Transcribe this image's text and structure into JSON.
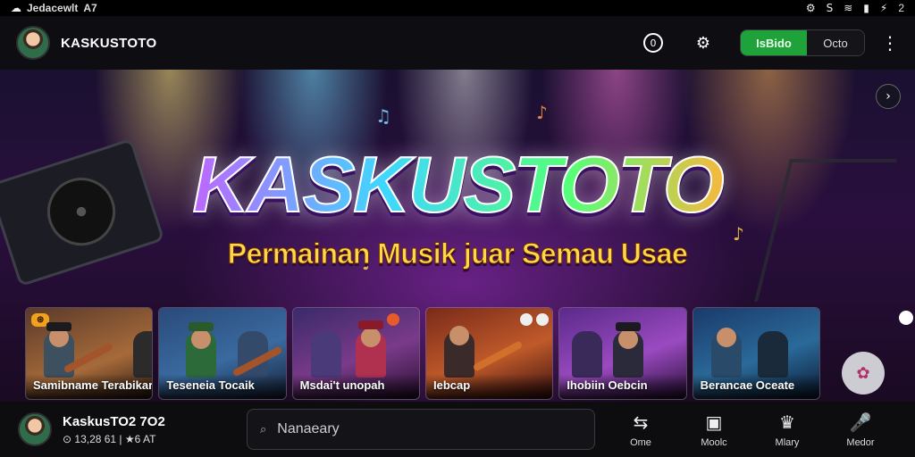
{
  "status_bar": {
    "left_icon": "cloud-icon",
    "left_text": "Jedacewlt",
    "clock": "A7",
    "right_glyphs": [
      "⚙",
      "S",
      "⚡"
    ],
    "battery_text": "2"
  },
  "app_bar": {
    "title": "KASKUSTOTO",
    "ring_button_text": "0",
    "toggle_on_label": "IsBido",
    "toggle_off_label": "Octo"
  },
  "hero": {
    "title": "KASKUSTOTO",
    "subtitle": "Permainan Musik juar Semau Usae"
  },
  "cards": [
    {
      "caption": "Samibname   Terabikar",
      "badge": ""
    },
    {
      "caption": "Teseneia Tocaik",
      "badge": ""
    },
    {
      "caption": "Msdai't unopah",
      "badge": ""
    },
    {
      "caption": "Iebcap",
      "badge": ""
    },
    {
      "caption": "Ihobiin Oebcin",
      "badge": ""
    },
    {
      "caption": "Berancae Oceate",
      "badge": ""
    }
  ],
  "bottom_bar": {
    "user_name": "KaskusTO2 7O2",
    "user_stats": "⊙ 13,28 61  |  ★6 AT",
    "search_placeholder": "Nanaeary",
    "nav": [
      {
        "icon": "game-icon",
        "glyph": "⇆",
        "label": "Ome"
      },
      {
        "icon": "music-icon",
        "glyph": "▣",
        "label": "Moolc"
      },
      {
        "icon": "profile-icon",
        "glyph": "♛",
        "label": "Mlary"
      },
      {
        "icon": "mic-icon",
        "glyph": "🎤",
        "label": "Medor"
      }
    ]
  },
  "colors": {
    "accent_green": "#1fa23a",
    "subtitle_gold": "#ffd84a",
    "background": "#0b0b0f"
  }
}
